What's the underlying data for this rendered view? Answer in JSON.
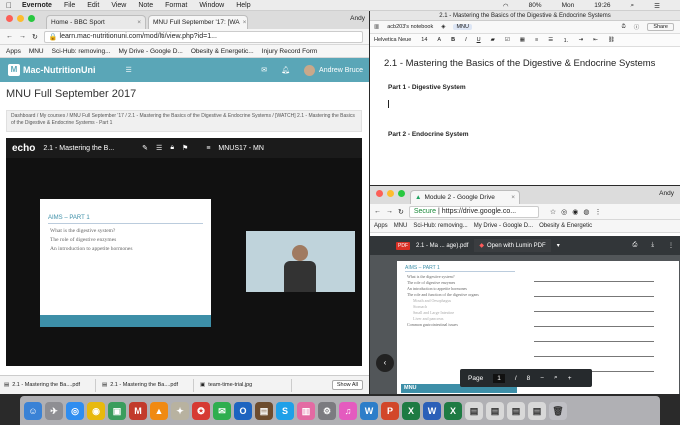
{
  "menubar": {
    "apple": "",
    "app": "Evernote",
    "items": [
      "File",
      "Edit",
      "View",
      "Note",
      "Format",
      "Window",
      "Help"
    ],
    "battery": "80%",
    "day": "Mon",
    "time": "19:26"
  },
  "left": {
    "tabs": [
      {
        "label": "Home - BBC Sport"
      },
      {
        "label": "MNU Full September '17: [WA"
      }
    ],
    "user": "Andy",
    "url": "learn.mac-nutritionuni.com/mod/lti/view.php?id=1...",
    "bookmarks": [
      "Apps",
      "MNU",
      "Sci-Hub: removing...",
      "My Drive - Google D...",
      "Obesity & Energetic...",
      "Injury Record Form"
    ],
    "site_logo": "Mac-NutritionUni",
    "user_name": "Andrew Bruce",
    "page_title": "MNU Full September 2017",
    "crumbs": "Dashboard / My courses / MNU Full September '17 / 2.1 - Mastering the Basics of the Digestive & Endocrine Systems / [WATCH] 2.1 - Mastering the Basics of the Digestive & Endocrine Systems - Part 1",
    "player": {
      "brand": "echo",
      "title": "2.1 - Mastering the B...",
      "course": "MNUS17 - MN",
      "slide_title": "AIMS – PART 1",
      "slide_points": [
        "What is the digestive system?",
        "The role of digestive enzymes",
        "An introduction to appetite hormones"
      ]
    },
    "downloads": [
      "2.1 - Mastering the Ba....pdf",
      "2.1 - Mastering the Ba....pdf",
      "team-time-trial.jpg"
    ],
    "show_all": "Show All"
  },
  "evernote": {
    "window_title": "2.1 - Mastering the Basics of the Digestive & Endocrine Systems",
    "notebook": "acb203's notebook",
    "tag": "MNU",
    "share": "Share",
    "font": "Helvetica Neue",
    "size": "14",
    "note_title": "2.1 - Mastering the Basics of the Digestive & Endocrine Systems",
    "part1": "Part 1 - Digestive System",
    "part2": "Part 2 - Endocrine System"
  },
  "drive": {
    "tab": "Module 2 - Google Drive",
    "user": "Andy",
    "secure": "Secure",
    "url": "https://drive.google.co...",
    "bookmarks": [
      "Apps",
      "MNU",
      "Sci-Hub: removing...",
      "My Drive - Google D...",
      "Obesity & Energetic"
    ],
    "file": "2.1 - Ma ... age).pdf",
    "open_with": "Open with Lumin PDF",
    "pdf_title": "AIMS – PART 1",
    "pdf_points": [
      "What is the digestive system?",
      "The role of digestive enzymes",
      "An introduction to appetite hormones",
      "The role and function of the digestive organs",
      "Mouth and Oesophagus",
      "Stomach",
      "Small and Large Intestine",
      "Liver and pancreas",
      "Common gastrointestinal issues"
    ],
    "pdf_footer": "MNU",
    "page_label": "Page",
    "page": "1",
    "slash": "/",
    "pages": "8"
  },
  "colors": {
    "teal": "#5aa6b7",
    "slide": "#3d8fa8"
  },
  "dock_icons": [
    "finder-icon",
    "launchpad-icon",
    "safari-icon",
    "chrome-icon",
    "app-icon",
    "mail-icon",
    "vlc-icon",
    "app-icon",
    "app-icon",
    "messages-icon",
    "outlook-icon",
    "app-icon",
    "skype-icon",
    "app-icon",
    "settings-icon",
    "itunes-icon",
    "app-icon",
    "powerpoint-icon",
    "excel-icon",
    "word-icon",
    "excel-icon",
    "trash-icon"
  ]
}
